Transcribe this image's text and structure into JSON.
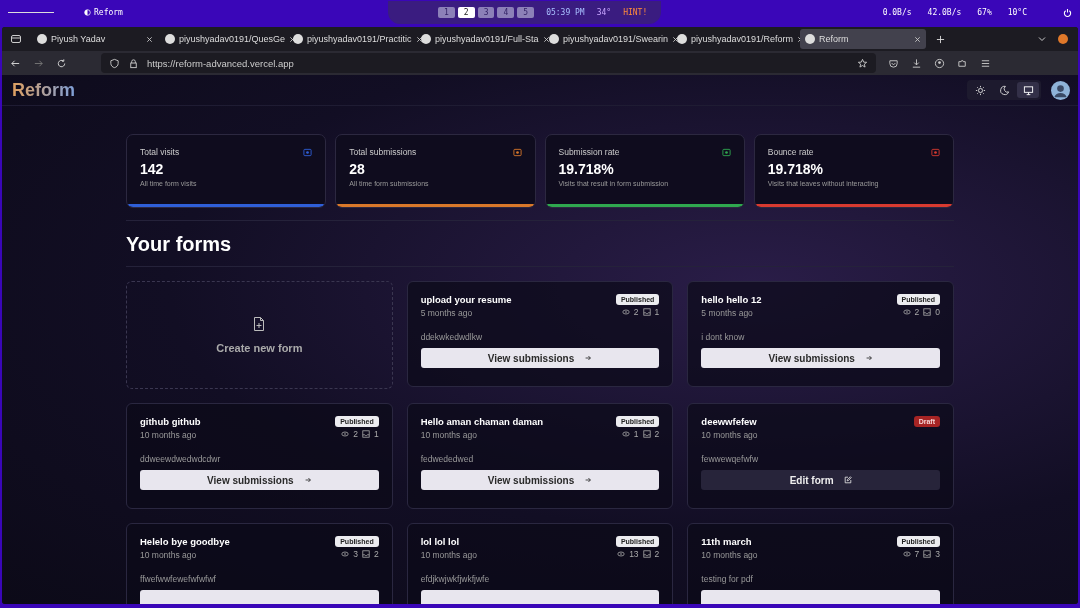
{
  "system_bar": {
    "app_title": "Reform",
    "workspaces": [
      {
        "label": "1",
        "selected": false
      },
      {
        "label": "2",
        "selected": true
      },
      {
        "label": "3",
        "selected": false
      },
      {
        "label": "4",
        "selected": false
      },
      {
        "label": "5",
        "selected": false
      }
    ],
    "time": "05:39 PM",
    "temperature": "34°",
    "hint": "HINT!",
    "upload": "0.0B/s",
    "download": "42.0B/s",
    "battery": "67%",
    "weather": "10°C"
  },
  "tabs": [
    {
      "title": "Piyush Yadav",
      "selected": false
    },
    {
      "title": "piyushyadav0191/QuesGe",
      "selected": false
    },
    {
      "title": "piyushyadav0191/Practitic",
      "selected": false
    },
    {
      "title": "piyushyadav0191/Full-Sta",
      "selected": false
    },
    {
      "title": "piyushyadav0191/Swearin",
      "selected": false
    },
    {
      "title": "piyushyadav0191/Reform",
      "selected": false
    },
    {
      "title": "Reform",
      "selected": true
    }
  ],
  "address_bar": {
    "url": "https://reform-advanced.vercel.app"
  },
  "app": {
    "logo": "Reform",
    "theme_modes": [
      {
        "kind": "light",
        "selected": false
      },
      {
        "kind": "dark",
        "selected": false
      },
      {
        "kind": "system",
        "selected": true
      }
    ]
  },
  "stats": [
    {
      "title": "Total visits",
      "value": "142",
      "helper": "All time form visits",
      "color": "#2f5fd8"
    },
    {
      "title": "Total submissions",
      "value": "28",
      "helper": "All time form submissions",
      "color": "#d9782a"
    },
    {
      "title": "Submission rate",
      "value": "19.718%",
      "helper": "Visits that result in form submission",
      "color": "#2fa84f"
    },
    {
      "title": "Bounce rate",
      "value": "19.718%",
      "helper": "Visits that leaves without interacting",
      "color": "#d83a30"
    }
  ],
  "forms_heading": "Your forms",
  "create_card": {
    "label": "Create new form"
  },
  "forms": [
    {
      "name": "upload your resume",
      "published": true,
      "badge": "Published",
      "time": "5 months ago",
      "visits": "2",
      "submissions": "1",
      "description": "ddekwkedwdlkw",
      "button": "View submissions"
    },
    {
      "name": "hello hello 12",
      "published": true,
      "badge": "Published",
      "time": "5 months ago",
      "visits": "2",
      "submissions": "0",
      "description": "i dont know",
      "button": "View submissions"
    },
    {
      "name": "github github",
      "published": true,
      "badge": "Published",
      "time": "10 months ago",
      "visits": "2",
      "submissions": "1",
      "description": "ddweewdwedwdcdwr",
      "button": "View submissions"
    },
    {
      "name": "Hello aman chaman daman",
      "published": true,
      "badge": "Published",
      "time": "10 months ago",
      "visits": "1",
      "submissions": "2",
      "description": "fedwededwed",
      "button": "View submissions"
    },
    {
      "name": "deewwfefew",
      "published": false,
      "badge": "Draft",
      "time": "10 months ago",
      "description": "fewwewqefwfw",
      "button": "Edit form"
    },
    {
      "name": "Helelo bye goodbye",
      "published": true,
      "badge": "Published",
      "time": "10 months ago",
      "visits": "3",
      "submissions": "2",
      "description": "ffwefwwfewefwfwfwf"
    },
    {
      "name": "lol lol lol",
      "published": true,
      "badge": "Published",
      "time": "10 months ago",
      "visits": "13",
      "submissions": "2",
      "description": "efdjkwjwkfjwkfjwfe"
    },
    {
      "name": "11th march",
      "published": true,
      "badge": "Published",
      "time": "10 months ago",
      "visits": "7",
      "submissions": "3",
      "description": "testing for pdf"
    }
  ]
}
